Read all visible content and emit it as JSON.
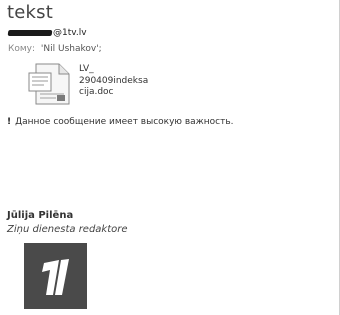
{
  "email": {
    "subject": "tekst",
    "sender_visible": "@1tv.lv",
    "to_label": "Кому:",
    "to_value": "'Nil Ushakov';",
    "attachment": {
      "name": "LV_\n290409indeksa\ncija.doc",
      "icon": "doc-icon"
    },
    "importance_mark": "!",
    "importance_text": "Данное сообщение имеет высокую важность."
  },
  "signature": {
    "name": "Jūlija Pilēna",
    "role": "Ziņu dienesta redaktore",
    "logo": "channel-one-logo"
  },
  "colors": {
    "background": "#ffffff",
    "logo_bg": "#4a4a4a",
    "logo_fg": "#ffffff"
  }
}
